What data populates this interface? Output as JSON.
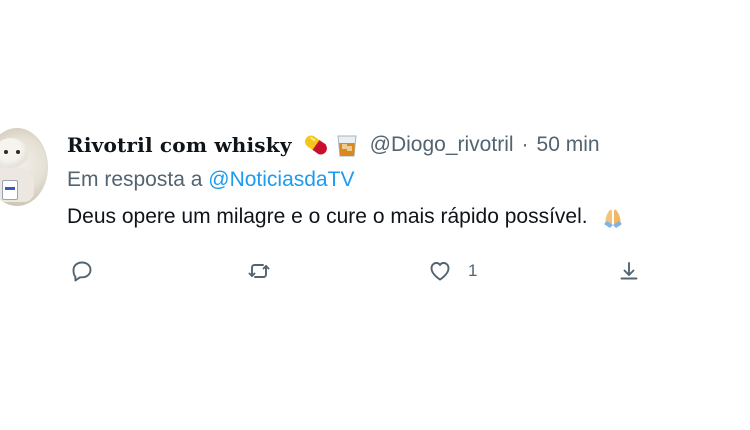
{
  "tweet": {
    "display_name": "Rivotril com whisky",
    "name_emojis": [
      "pill-emoji",
      "tumbler-glass-emoji"
    ],
    "handle": "@Diogo_rivotril",
    "separator": "·",
    "time": "50 min",
    "reply_prefix": "Em resposta a",
    "reply_to": "@NoticiasdaTV",
    "text": "Deus opere um milagre e o cure o mais rápido possível.",
    "text_emoji": "folded-hands-emoji"
  },
  "actions": {
    "reply": {
      "icon": "reply-icon"
    },
    "retweet": {
      "icon": "retweet-icon"
    },
    "like": {
      "icon": "heart-icon",
      "count": "1"
    },
    "share": {
      "icon": "share-icon"
    }
  },
  "colors": {
    "text_primary": "#0f1419",
    "text_secondary": "#536471",
    "link": "#1d9bf0",
    "background": "#ffffff"
  }
}
